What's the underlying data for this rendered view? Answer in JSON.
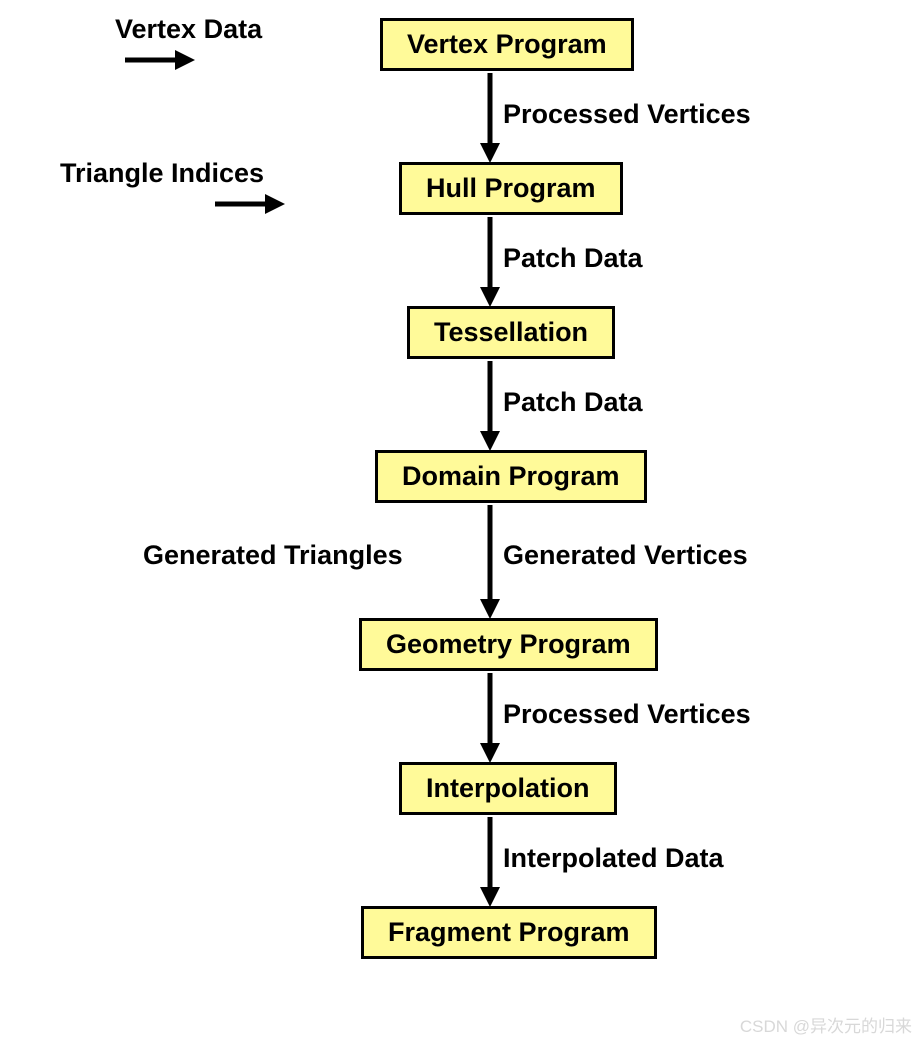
{
  "stages": {
    "vertex": "Vertex Program",
    "hull": "Hull Program",
    "tessellation": "Tessellation",
    "domain": "Domain Program",
    "geometry": "Geometry Program",
    "interpolation": "Interpolation",
    "fragment": "Fragment Program"
  },
  "inputs": {
    "vertex_data": "Vertex Data",
    "triangle_indices": "Triangle Indices"
  },
  "edges": {
    "vertex_to_hull": "Processed Vertices",
    "hull_to_tess": "Patch Data",
    "tess_to_domain": "Patch Data",
    "domain_to_geom_left": "Generated Triangles",
    "domain_to_geom_right": "Generated Vertices",
    "geom_to_interp": "Processed Vertices",
    "interp_to_frag": "Interpolated Data"
  },
  "watermark": "CSDN @异次元的归来"
}
